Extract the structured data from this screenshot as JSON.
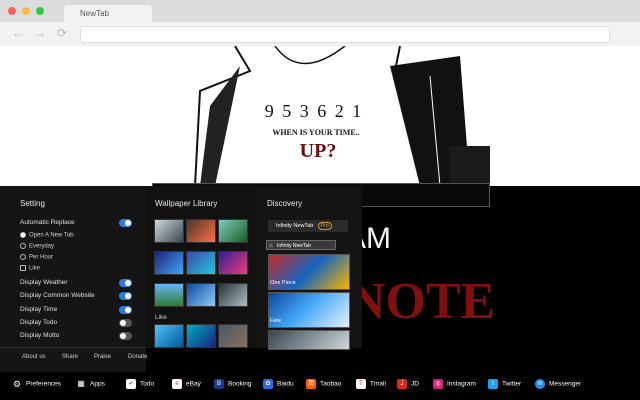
{
  "browser": {
    "tab_title": "NewTab",
    "back_icon": "←",
    "forward_icon": "→",
    "reload_icon": "⟳"
  },
  "wallpaper": {
    "shirt_numbers": "9 5 3 6 2 1",
    "shirt_line": "WHEN IS YOUR TIME..",
    "shirt_up": "UP?",
    "motto_partial": "AM",
    "title_partial": "NOTE"
  },
  "settings": {
    "title": "Setting",
    "automatic_replace": "Automatic Replace",
    "open_options": [
      "Open A New Tab",
      "Everyday",
      "Per Hour",
      "Like"
    ],
    "selected_option": "Open A New Tab",
    "toggles": [
      {
        "label": "Display Weather",
        "on": true
      },
      {
        "label": "Display Common Website",
        "on": true
      },
      {
        "label": "Display Time",
        "on": true
      },
      {
        "label": "Display Todo",
        "on": false
      },
      {
        "label": "Display Motto",
        "on": false
      }
    ],
    "footer_links": [
      "About us",
      "Share",
      "Praise",
      "Donate"
    ]
  },
  "wallpaper_library": {
    "title": "Wallpaper Library",
    "like_label": "Like"
  },
  "discovery": {
    "title": "Discovery",
    "tab_label": "Infinity NewTab",
    "tab_badge": "Pro",
    "tooltip": "Infinity NewTab",
    "items": [
      "One Piece",
      "Fate"
    ]
  },
  "bottom_bar": [
    {
      "label": "Preferences",
      "icon": "gear-icon",
      "color": "#000000"
    },
    {
      "label": "Apps",
      "icon": "apps-grid-icon",
      "color": "#000000"
    },
    {
      "label": "Todo",
      "icon": "checkbox-icon",
      "color": "#ffffff"
    },
    {
      "label": "eBay",
      "icon": "ebay-icon",
      "color": "#ffffff"
    },
    {
      "label": "Booking",
      "icon": "booking-icon",
      "color": "#1b3a8a"
    },
    {
      "label": "Baidu",
      "icon": "baidu-icon",
      "color": "#2d6bea"
    },
    {
      "label": "Taobao",
      "icon": "taobao-icon",
      "color": "#ff5a00"
    },
    {
      "label": "Tmall",
      "icon": "tmall-icon",
      "color": "#ffffff"
    },
    {
      "label": "JD",
      "icon": "jd-icon",
      "color": "#e1251b"
    },
    {
      "label": "Instagram",
      "icon": "instagram-icon",
      "color": "#d6247b"
    },
    {
      "label": "Twitter",
      "icon": "twitter-icon",
      "color": "#1da1f2"
    },
    {
      "label": "Messenger",
      "icon": "messenger-icon",
      "color": "#1f8ef1"
    }
  ]
}
